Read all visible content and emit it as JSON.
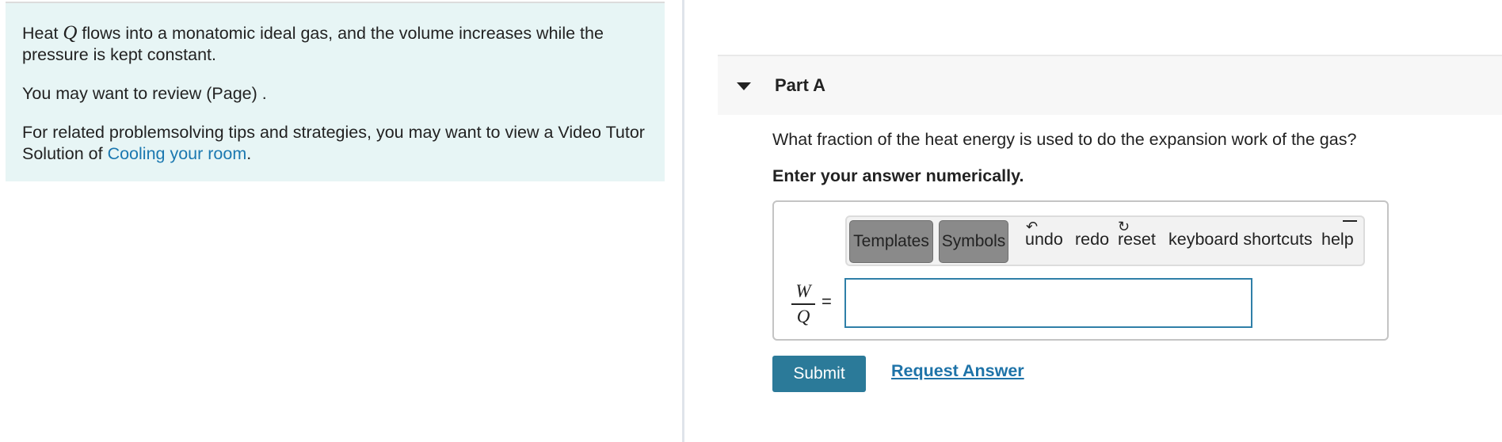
{
  "problem": {
    "text_before_var": "Heat ",
    "var_q": "Q",
    "text_after_var": " flows into a monatomic ideal gas, and the volume increases while the pressure is kept constant.",
    "review_text": "You may want to review (Page) .",
    "tips_text": "For related problemsolving tips and strategies, you may want to view a Video Tutor Solution of ",
    "tips_link": "Cooling your room",
    "tips_end": "."
  },
  "part": {
    "title": "Part A",
    "question": "What fraction of the heat energy is used to do the expansion work of the gas?",
    "instruction": "Enter your answer numerically."
  },
  "toolbar": {
    "templates_label": "Templates",
    "symbols_label": "Symbols",
    "undo_label": "undo",
    "redo_label": "redo",
    "reset_label": "reset",
    "shortcuts_label": "keyboard shortcuts",
    "help_label": "help"
  },
  "answer": {
    "numerator": "W",
    "denominator": "Q",
    "equals": "=",
    "value": ""
  },
  "actions": {
    "submit_label": "Submit",
    "request_label": "Request Answer"
  },
  "colors": {
    "panel_bg": "#e7f5f5",
    "link": "#1b78b0",
    "submit_bg": "#2b7a99",
    "input_border": "#2f7fa8"
  }
}
